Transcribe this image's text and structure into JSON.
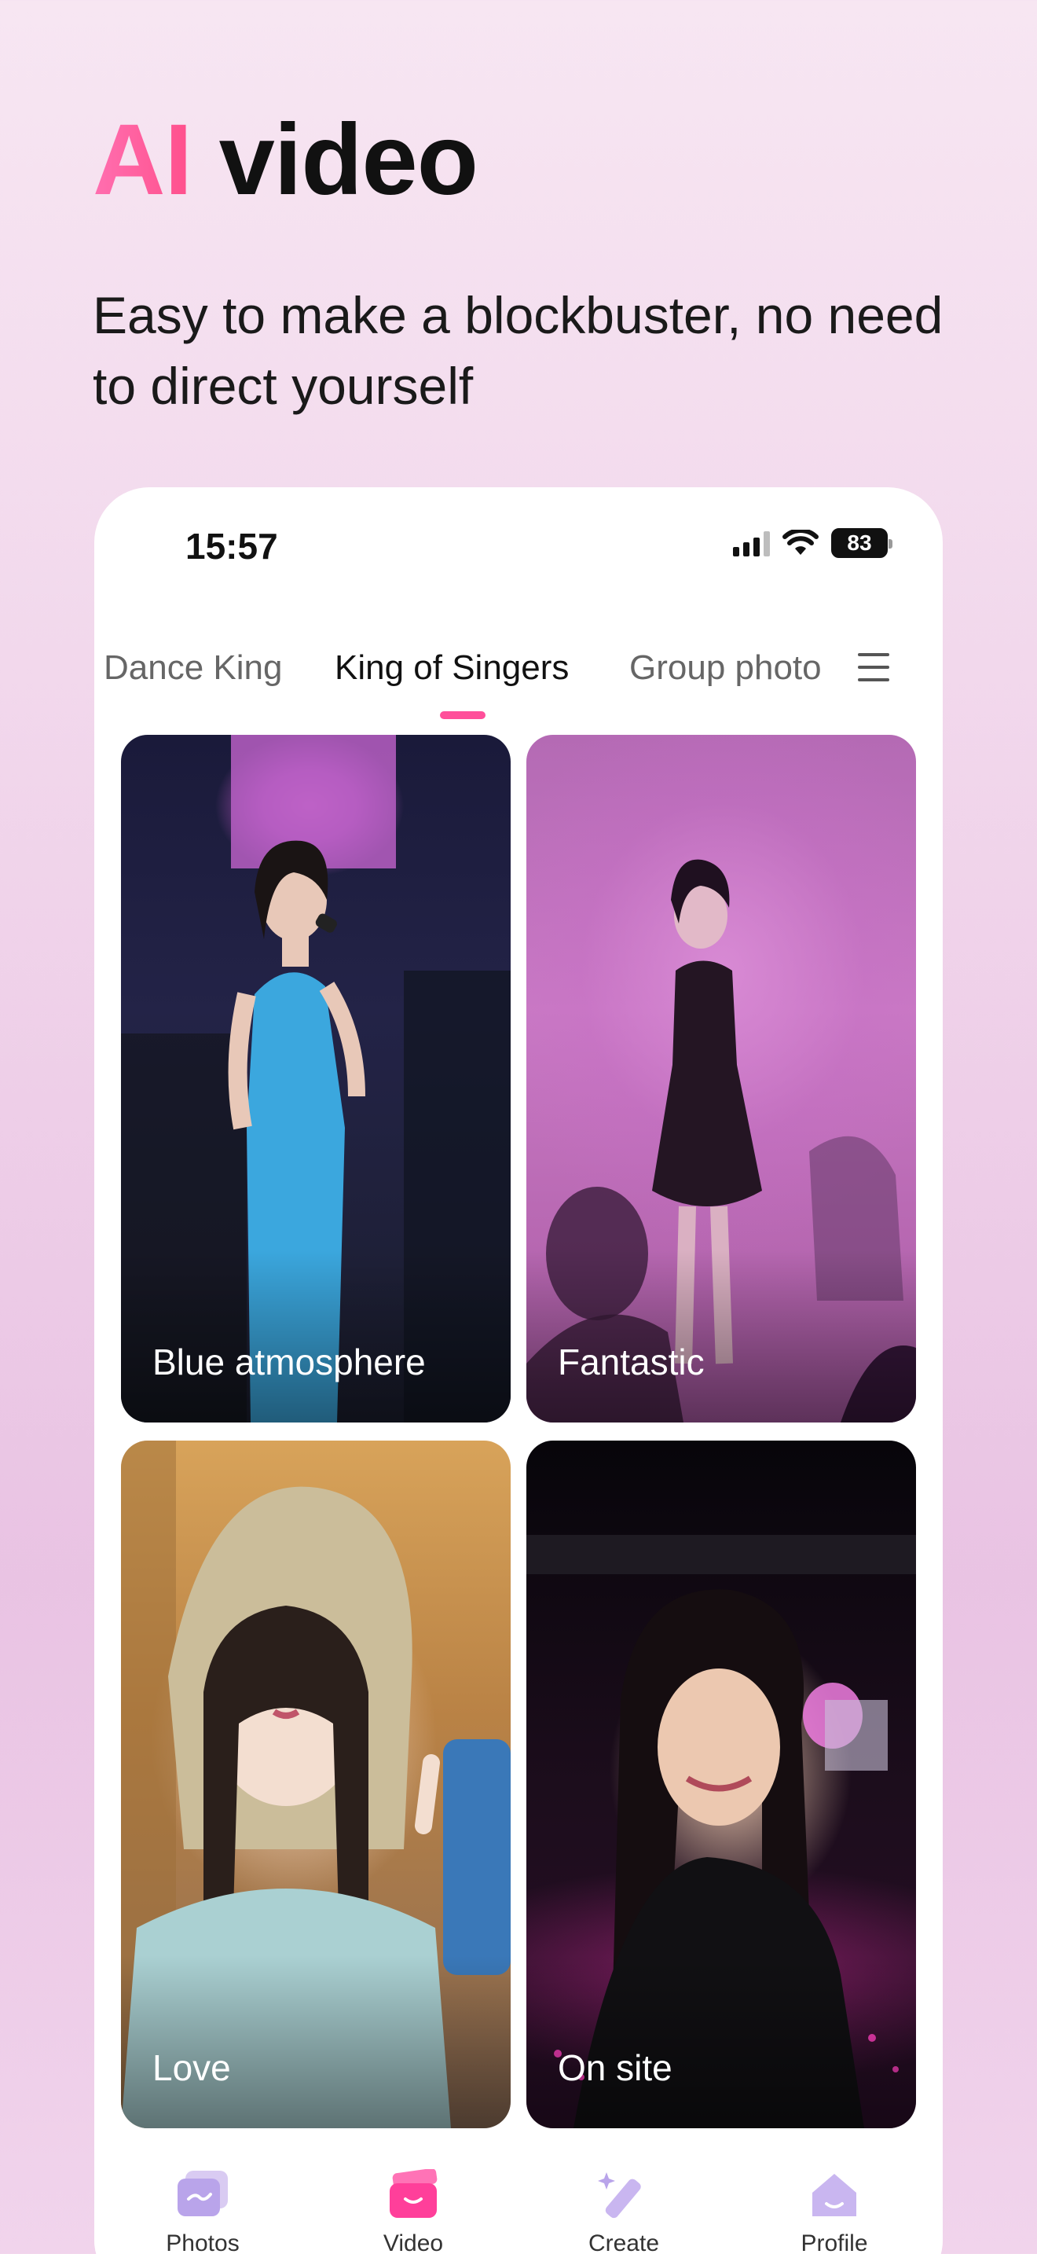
{
  "hero": {
    "title_accent": "AI",
    "title_rest": " video",
    "subtitle": "Easy to make a blockbuster, no need to direct yourself"
  },
  "status_bar": {
    "time": "15:57",
    "battery": "83"
  },
  "tabs": [
    {
      "label": "Dance King",
      "active": false
    },
    {
      "label": "King of Singers",
      "active": true
    },
    {
      "label": "Group photo",
      "active": false
    }
  ],
  "menu_icon": "hamburger-menu-icon",
  "cards": [
    {
      "label": "Blue atmosphere"
    },
    {
      "label": "Fantastic"
    },
    {
      "label": "Love"
    },
    {
      "label": "On site"
    }
  ],
  "bottom_nav": [
    {
      "label": "Photos",
      "icon": "photos-icon"
    },
    {
      "label": "Video",
      "icon": "video-icon",
      "active": true
    },
    {
      "label": "Create",
      "icon": "create-icon"
    },
    {
      "label": "Profile",
      "icon": "profile-icon"
    }
  ],
  "colors": {
    "accent": "#ff4f9a",
    "nav_icon": "#c9b2ee"
  }
}
